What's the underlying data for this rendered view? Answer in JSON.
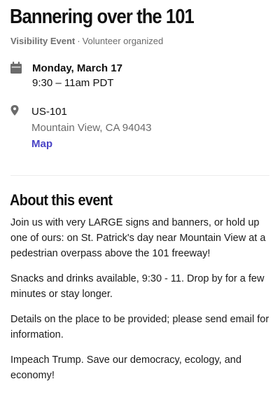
{
  "event": {
    "title": "Bannering over the 101",
    "type_label": "Visibility Event",
    "separator": "·",
    "organizer_label": "Volunteer organized"
  },
  "date": {
    "icon": "calendar-icon",
    "day": "Monday, March 17",
    "time": "9:30 – 11am PDT"
  },
  "location": {
    "icon": "map-pin-icon",
    "address_line1": "US-101",
    "address_line2": "Mountain View, CA 94043",
    "map_link": "Map"
  },
  "about": {
    "heading": "About this event",
    "paragraphs": [
      "Join us with very LARGE signs and banners, or hold up one of ours: on St. Patrick's day near Mountain View at a pedestrian overpass above the 101 freeway!",
      "Snacks and drinks available, 9:30 - 11. Drop by for a few minutes or stay longer.",
      "Details on the place to be provided; please send email for information.",
      "Impeach Trump. Save our democracy, ecology, and economy!"
    ]
  },
  "colors": {
    "link": "#4a44c6",
    "muted_text": "#6b6b6b",
    "icon": "#6b6b6b"
  }
}
